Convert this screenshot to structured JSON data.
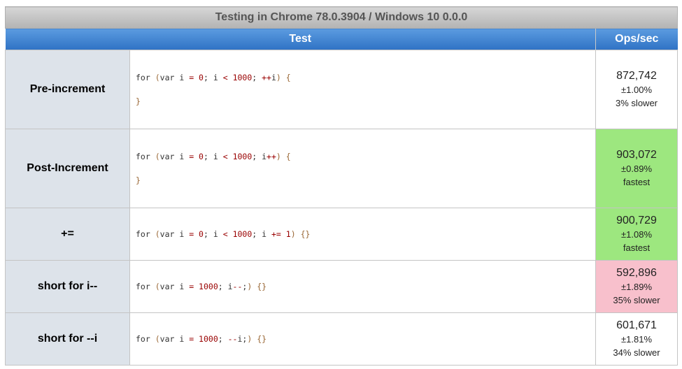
{
  "caption": "Testing in Chrome 78.0.3904 / Windows 10 0.0.0",
  "header": {
    "test": "Test",
    "ops": "Ops/sec"
  },
  "colors": {
    "fastest": "#9de77f",
    "slowest": "#f8c0cc",
    "default": "#ffffff",
    "name_bg": "#dde3ea",
    "header_blue": "#3f80d0"
  },
  "rows": [
    {
      "name": "Pre-increment",
      "code_lines": [
        "for (var i = 0; i < 1000; ++i) {",
        "}"
      ],
      "hz": "872,742",
      "rme": "±1.00%",
      "rel": "3% slower",
      "status": "default"
    },
    {
      "name": "Post-Increment",
      "code_lines": [
        "for (var i = 0; i < 1000; i++) {",
        "}"
      ],
      "hz": "903,072",
      "rme": "±0.89%",
      "rel": "fastest",
      "status": "fastest"
    },
    {
      "name": "+=",
      "code_lines": [
        "for (var i = 0; i < 1000; i += 1) {}"
      ],
      "hz": "900,729",
      "rme": "±1.08%",
      "rel": "fastest",
      "status": "fastest"
    },
    {
      "name": "short for i--",
      "code_lines": [
        "for (var i = 1000; i--;) {}"
      ],
      "hz": "592,896",
      "rme": "±1.89%",
      "rel": "35% slower",
      "status": "slowest"
    },
    {
      "name": "short for --i",
      "code_lines": [
        "for (var i = 1000; --i;) {}"
      ],
      "hz": "601,671",
      "rme": "±1.81%",
      "rel": "34% slower",
      "status": "default"
    }
  ]
}
